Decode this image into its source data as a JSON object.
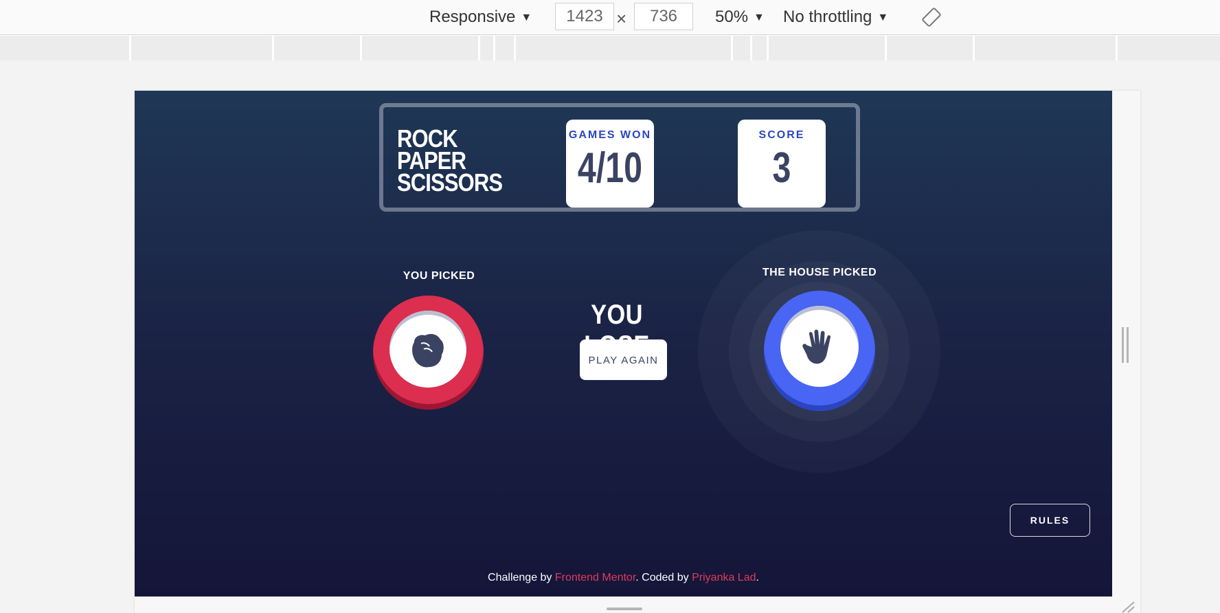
{
  "devtools": {
    "device": "Responsive",
    "width": "1423",
    "height": "736",
    "dimension_separator": "×",
    "zoom": "50%",
    "throttling": "No throttling",
    "dropdown_caret": "▼"
  },
  "header": {
    "title_lines": [
      "ROCK",
      "PAPER",
      "SCISSORS"
    ],
    "games_won_label": "GAMES WON",
    "games_won_value": "4/10",
    "score_label": "SCORE",
    "score_value": "3"
  },
  "game": {
    "you_picked_label": "YOU PICKED",
    "house_picked_label": "THE HOUSE PICKED",
    "player_pick_icon": "rock-icon",
    "house_pick_icon": "paper-icon",
    "result_text": "YOU LOSE",
    "play_again_label": "PLAY AGAIN"
  },
  "rules_label": "RULES",
  "footer": {
    "prefix": "Challenge by ",
    "link1": "Frontend Mentor",
    "middle": ". Coded by ",
    "link2": "Priyanka Lad",
    "suffix": "."
  },
  "colors": {
    "rock": "#dc2e4e",
    "paper": "#4865f4",
    "link": "#e03b5a",
    "score_label": "#2a46c0",
    "dark_text": "#3b4363"
  }
}
